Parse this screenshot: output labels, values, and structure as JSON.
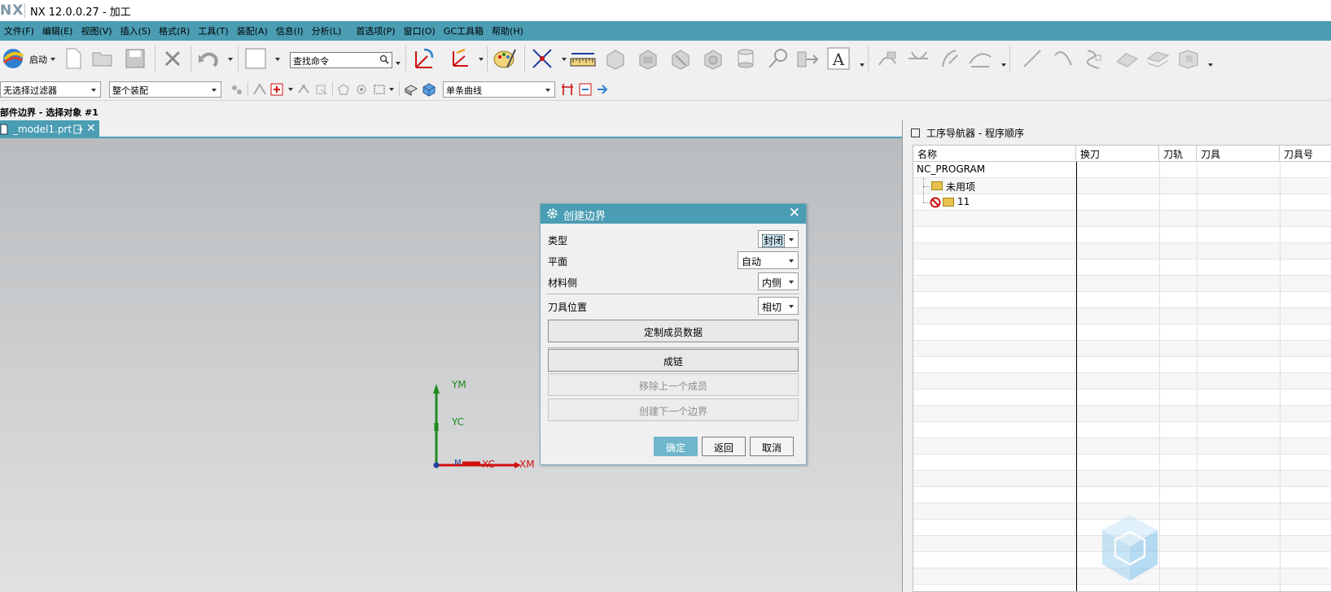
{
  "app": {
    "logo": "NX",
    "title": "NX 12.0.0.27 - 加工"
  },
  "menu": [
    "文件(F)",
    "编辑(E)",
    "视图(V)",
    "插入(S)",
    "格式(R)",
    "工具(T)",
    "装配(A)",
    "信息(I)",
    "分析(L)",
    "首选项(P)",
    "窗口(O)",
    "GC工具箱",
    "帮助(H)"
  ],
  "toolbar": {
    "start_label": "启动",
    "command_search_value": "查找命令"
  },
  "selection_bar": {
    "filter": "无选择过滤器",
    "scope": "整个装配",
    "curve_rule": "单条曲线"
  },
  "status": "部件边界 - 选择对象 #1",
  "document_tab": "_model1.prt",
  "csys": {
    "ym": "YM",
    "yc": "YC",
    "xc": "XC",
    "xm": "XM",
    "origin": "M"
  },
  "navigator": {
    "title": "工序导航器 - 程序顺序",
    "columns": [
      "名称",
      "换刀",
      "刀轨",
      "刀具",
      "刀具号"
    ],
    "rows": [
      {
        "name": "NC_PROGRAM"
      },
      {
        "name": "未用项"
      },
      {
        "name": "11"
      }
    ]
  },
  "dialog": {
    "title": "创建边界",
    "fields": [
      {
        "label": "类型",
        "value": "封闭"
      },
      {
        "label": "平面",
        "value": "自动"
      },
      {
        "label": "材料侧",
        "value": "内侧"
      },
      {
        "label": "刀具位置",
        "value": "相切"
      }
    ],
    "custom_member_button": "定制成员数据",
    "chain_button": "成链",
    "remove_prev_button": "移除上一个成员",
    "create_next_button": "创建下一个边界",
    "ok_button": "确定",
    "back_button": "返回",
    "cancel_button": "取消"
  },
  "colors": {
    "accent": "#4a9db3",
    "primary_button": "#6fb5cc",
    "x_axis": "#d01010",
    "y_axis": "#1f8a1f"
  }
}
